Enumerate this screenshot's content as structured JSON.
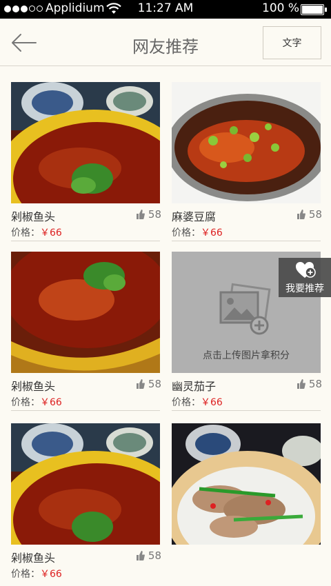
{
  "status_bar": {
    "carrier": "Applidium",
    "time": "11:27 AM",
    "battery": "100 %"
  },
  "nav": {
    "title": "网友推荐",
    "text_button": "文字"
  },
  "recommend_button": {
    "label": "我要推荐"
  },
  "colors": {
    "price": "#dd2222",
    "background": "#fcfaf3",
    "upload_bg": "#b0b0b0"
  },
  "items": [
    {
      "name": "剁椒鱼头",
      "likes": "58",
      "price_label": "价格：",
      "price": "￥66",
      "photo": "chili-fish-head-photo"
    },
    {
      "name": "麻婆豆腐",
      "likes": "58",
      "price_label": "价格：",
      "price": "￥66",
      "photo": "braised-fish-photo"
    },
    {
      "name": "剁椒鱼头",
      "likes": "58",
      "price_label": "价格：",
      "price": "￥66",
      "photo": "chili-fish-head-photo"
    },
    {
      "name": "幽灵茄子",
      "likes": "58",
      "price_label": "价格：",
      "price": "￥66",
      "photo": "upload-placeholder",
      "upload_label": "点击上传图片拿积分"
    },
    {
      "name": "剁椒鱼头",
      "likes": "58",
      "price_label": "价格：",
      "price": "￥66",
      "photo": "chili-fish-head-photo"
    },
    {
      "name": "",
      "likes": "",
      "price_label": "",
      "price": "",
      "photo": "sliced-meat-photo"
    }
  ]
}
